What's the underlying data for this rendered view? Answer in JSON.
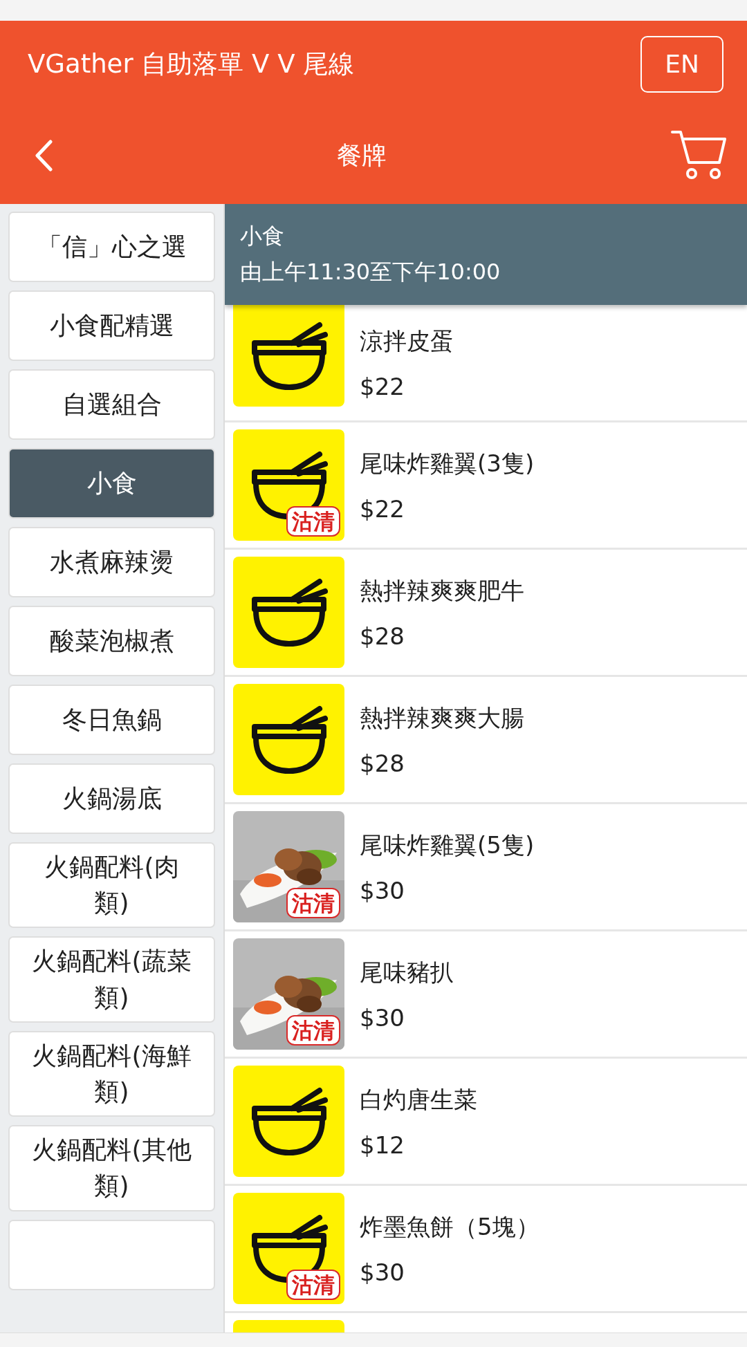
{
  "header": {
    "title": "VGather 自助落單 V V 尾線",
    "language_button": "EN"
  },
  "nav": {
    "title": "餐牌"
  },
  "categories": [
    {
      "label": "「信」心之選",
      "selected": false
    },
    {
      "label": "小食配精選",
      "selected": false
    },
    {
      "label": "自選組合",
      "selected": false
    },
    {
      "label": "小食",
      "selected": true
    },
    {
      "label": "水煮麻辣燙",
      "selected": false
    },
    {
      "label": "酸菜泡椒煮",
      "selected": false
    },
    {
      "label": "冬日魚鍋",
      "selected": false
    },
    {
      "label": "火鍋湯底",
      "selected": false
    },
    {
      "label": "火鍋配料(肉類)",
      "selected": false
    },
    {
      "label": "火鍋配料(蔬菜類)",
      "selected": false
    },
    {
      "label": "火鍋配料(海鮮類)",
      "selected": false
    },
    {
      "label": "火鍋配料(其他類)",
      "selected": false
    }
  ],
  "section": {
    "title": "小食",
    "hours": "由上午11:30至下午10:00"
  },
  "items": [
    {
      "name": "涼拌皮蛋",
      "price": "$22",
      "kind": "icon"
    },
    {
      "name": "尾味炸雞翼(3隻)",
      "price": "$22",
      "kind": "icon",
      "badge": "沽清"
    },
    {
      "name": "熱拌辣爽爽肥牛",
      "price": "$28",
      "kind": "icon"
    },
    {
      "name": "熱拌辣爽爽大腸",
      "price": "$28",
      "kind": "icon"
    },
    {
      "name": "尾味炸雞翼(5隻)",
      "price": "$30",
      "kind": "picture",
      "badge": "沽清"
    },
    {
      "name": "尾味豬扒",
      "price": "$30",
      "kind": "picture",
      "badge": "沽清"
    },
    {
      "name": "白灼唐生菜",
      "price": "$12",
      "kind": "icon"
    },
    {
      "name": "炸墨魚餅（5塊）",
      "price": "$30",
      "kind": "icon",
      "badge": "沽清"
    },
    {
      "kind": "icon"
    }
  ]
}
